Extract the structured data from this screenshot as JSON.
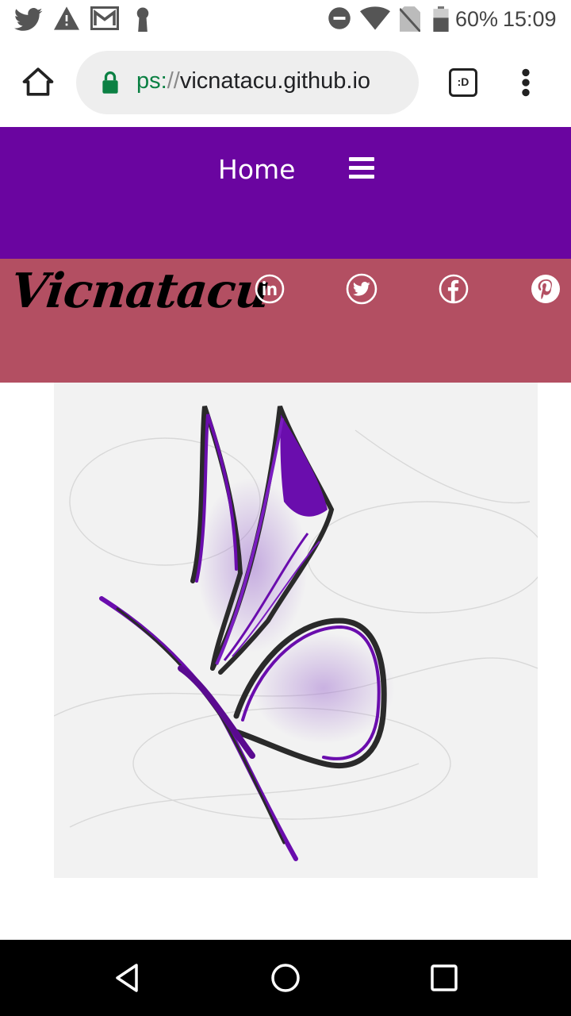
{
  "status_bar": {
    "battery": "60%",
    "time": "15:09"
  },
  "browser": {
    "url_scheme": "ps:",
    "url_sep": "//",
    "url_host": "vicnatacu.github.io",
    "tab_button_label": ":D"
  },
  "nav": {
    "home_label": "Home"
  },
  "header": {
    "logo_text": "Vicnatacu"
  },
  "social_icons": [
    "linkedin-icon",
    "twitter-icon",
    "facebook-icon",
    "pinterest-icon"
  ],
  "colors": {
    "nav_bg": "#6a05a0",
    "header_bg": "#b34f62",
    "butterfly_purple": "#6a0dad"
  }
}
